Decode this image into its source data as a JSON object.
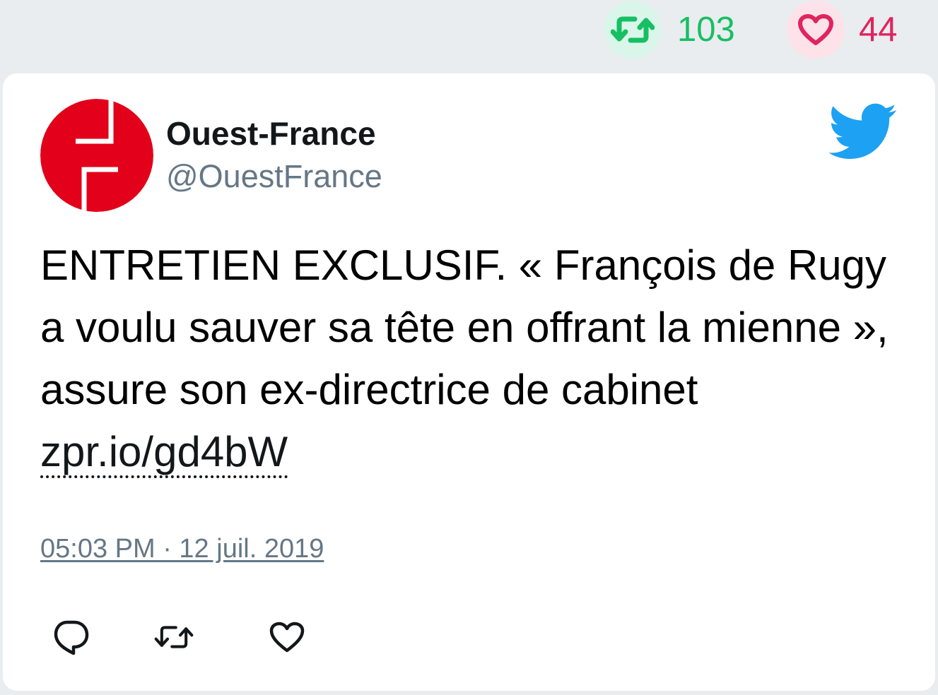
{
  "stats": {
    "retweet_count": "103",
    "like_count": "44",
    "retweet_color": "#17bf63",
    "like_color": "#e0245e",
    "retweet_icon": "retweet-icon",
    "like_icon": "heart-icon"
  },
  "tweet": {
    "author_name": "Ouest-France",
    "author_handle": "@OuestFrance",
    "avatar_icon": "ouest-france-logo",
    "brand_icon": "twitter-bird-icon",
    "brand_color": "#1da1f2",
    "text_before_link": "ENTRETIEN EXCLUSIF. « François de Rugy a voulu sauver sa tête en offrant la mienne », assure son ex-directrice de cabinet ",
    "link_text": "zpr.io/gd4bW",
    "timestamp": "05:03 PM · 12 juil. 2019"
  },
  "actions": {
    "reply_icon": "reply-icon",
    "retweet_icon": "retweet-icon",
    "like_icon": "heart-icon"
  }
}
